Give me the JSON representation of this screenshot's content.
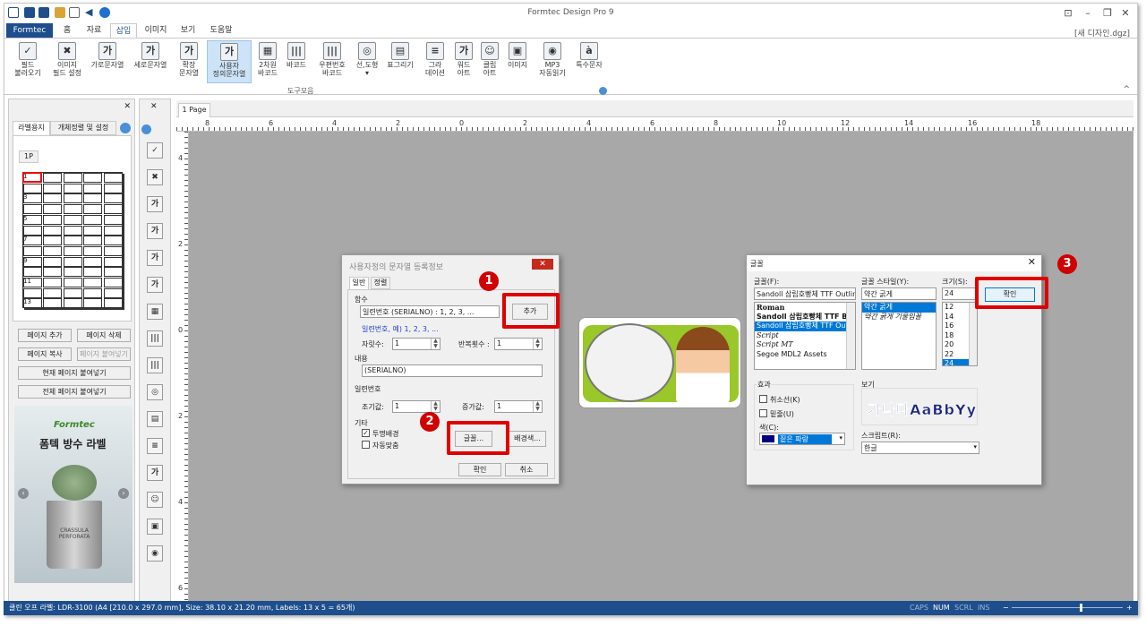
{
  "app": {
    "title": "Formtec Design Pro 9",
    "doc_name": "[새 디자인.dgz]"
  },
  "tabs": [
    "Formtec",
    "홈",
    "자료",
    "삽입",
    "이미지",
    "보기",
    "도움말"
  ],
  "ribbon": {
    "buttons": [
      {
        "icon": "✓",
        "label": "필드\n불러오기"
      },
      {
        "icon": "✖",
        "label": "이미지\n필드 설정"
      },
      {
        "icon": "가",
        "label": "가로문자열"
      },
      {
        "icon": "가",
        "label": "세로문자열"
      },
      {
        "icon": "가",
        "label": "확장\n문자열"
      },
      {
        "icon": "가",
        "label": "사용자\n정의문자열"
      },
      {
        "icon": "▦",
        "label": "2차원\n바코드"
      },
      {
        "icon": "|||",
        "label": "바코드"
      },
      {
        "icon": "|||",
        "label": "우편번호\n바코드"
      },
      {
        "icon": "◎",
        "label": "선,도형\n▾"
      },
      {
        "icon": "▤",
        "label": "표그리기"
      },
      {
        "icon": "≡",
        "label": "그라\n데이션"
      },
      {
        "icon": "가",
        "label": "워드\n아트"
      },
      {
        "icon": "☺",
        "label": "클립\n아트"
      },
      {
        "icon": "▣",
        "label": "이미지"
      },
      {
        "icon": "◉",
        "label": "MP3\n자동읽기"
      },
      {
        "icon": "à",
        "label": "특수문자"
      }
    ],
    "group_label": "도구모음"
  },
  "left_panel": {
    "tabs": [
      "라벨용지",
      "개체정렬 및 설정"
    ],
    "page_tab": "1P",
    "row_numbers": [
      "1",
      "3",
      "5",
      "7",
      "9",
      "11",
      "13"
    ],
    "buttons": [
      "페이지 추가",
      "페이지 삭제",
      "페이지 복사",
      "페이지 붙여넣기",
      "현재 페이지 붙여넣기",
      "전체 페이지 붙여넣기"
    ],
    "ad": {
      "brand": "Formtec",
      "title": "폼텍 방수 라벨",
      "pot_text": "CRASSULA\nPERFORATA"
    }
  },
  "toolbox_icons": [
    "✓",
    "✖",
    "가",
    "가",
    "가",
    "가",
    "▦",
    "|||",
    "|||",
    "◎",
    "▤",
    "≡",
    "가",
    "☺",
    "▣",
    "◉"
  ],
  "page_tab": "1 Page",
  "ruler": {
    "h": [
      "8",
      "6",
      "4",
      "2",
      "0",
      "2",
      "4",
      "6",
      "8",
      "10",
      "12",
      "14",
      "16",
      "18"
    ],
    "v": [
      "4",
      "2",
      "0",
      "2",
      "4",
      "6"
    ]
  },
  "dialog1": {
    "title": "사용자정의 문자열 등록정보",
    "tabs": [
      "일반",
      "정렬"
    ],
    "func_label": "함수",
    "func_value": "일련번호 (SERIALNO) : 1, 2, 3, ...",
    "add_button": "추가",
    "func_hint": "일련번호, 예) 1, 2, 3, ...",
    "digits_label": "자릿수:",
    "digits_value": "1",
    "repeat_label": "반복횟수 :",
    "repeat_value": "1",
    "content_label": "내용",
    "content_value": "(SERIALNO)",
    "serial_label": "일련번호",
    "init_label": "조기값:",
    "init_value": "1",
    "inc_label": "증가값:",
    "inc_value": "1",
    "etc_label": "기타",
    "transparent_label": "투명배경",
    "autofit_label": "자동맞춤",
    "font_button": "글꼴...",
    "bgcolor_button": "배경색...",
    "ok": "확인",
    "cancel": "취소"
  },
  "dialog2": {
    "title": "글꼴",
    "font_label": "글꼴(F):",
    "font_value": "Sandoll 삼립호빵체 TTF Outline",
    "fonts": [
      "Roman",
      "Sandoll 삼립호빵체 TTF Basic",
      "Sandoll 삼립호빵체 TTF Outline",
      "Script",
      "Script MT",
      "Segoe MDL2 Assets"
    ],
    "style_label": "글꼴 스타일(Y):",
    "style_value": "약간 굵게",
    "styles": [
      "약간 굵게",
      "약간 굵게 기울임꼴"
    ],
    "size_label": "크기(S):",
    "size_value": "24",
    "sizes": [
      "12",
      "14",
      "16",
      "18",
      "20",
      "22",
      "24"
    ],
    "ok": "확인",
    "effects_label": "효과",
    "strike_label": "취소선(K)",
    "underline_label": "밑줄(U)",
    "color_label": "색(C):",
    "color_value": "짙은 파랑",
    "preview_label": "보기",
    "preview_text": "가나다AaBbYy",
    "script_label": "스크립트(R):",
    "script_value": "한글"
  },
  "badges": [
    "1",
    "2",
    "3"
  ],
  "statusbar": {
    "text": "클린 오프 라벨: LDR-3100 (A4 [210.0 x 297.0 mm], Size: 38.10 x 21.20 mm, Labels: 13 x 5 = 65개)",
    "indicators": [
      "CAPS",
      "NUM",
      "SCRL",
      "INS"
    ],
    "minus": "−",
    "plus": "+"
  }
}
